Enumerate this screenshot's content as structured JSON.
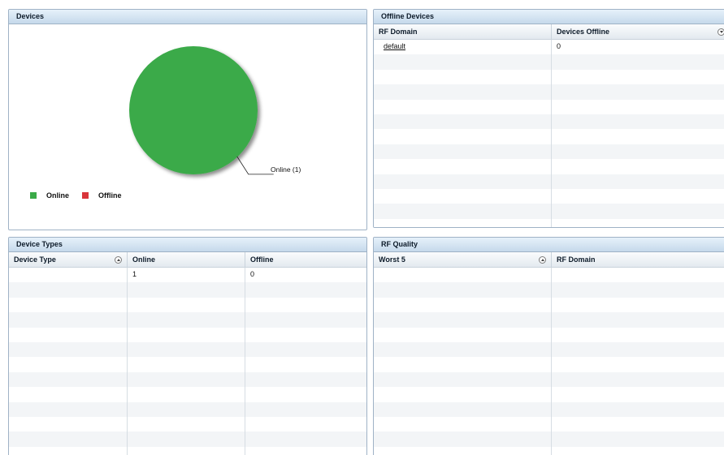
{
  "devices_panel": {
    "title": "Devices",
    "pie_label": "Online (1)",
    "legend": [
      {
        "label": "Online",
        "color": "#3aaa48"
      },
      {
        "label": "Offline",
        "color": "#d9353a"
      }
    ]
  },
  "chart_data": {
    "type": "pie",
    "categories": [
      "Online",
      "Offline"
    ],
    "values": [
      1,
      0
    ],
    "title": "",
    "legend_position": "bottom-left"
  },
  "offline_panel": {
    "title": "Offline Devices",
    "columns": [
      "RF Domain",
      "Devices Offline"
    ],
    "rows": [
      [
        "default",
        "0"
      ]
    ]
  },
  "types_panel": {
    "title": "Device Types",
    "columns": [
      "Device Type",
      "Online",
      "Offline"
    ],
    "rows": [
      [
        "",
        "1",
        "0"
      ]
    ]
  },
  "rfq_panel": {
    "title": "RF Quality",
    "columns": [
      "Worst 5",
      "RF Domain"
    ],
    "rows": []
  }
}
